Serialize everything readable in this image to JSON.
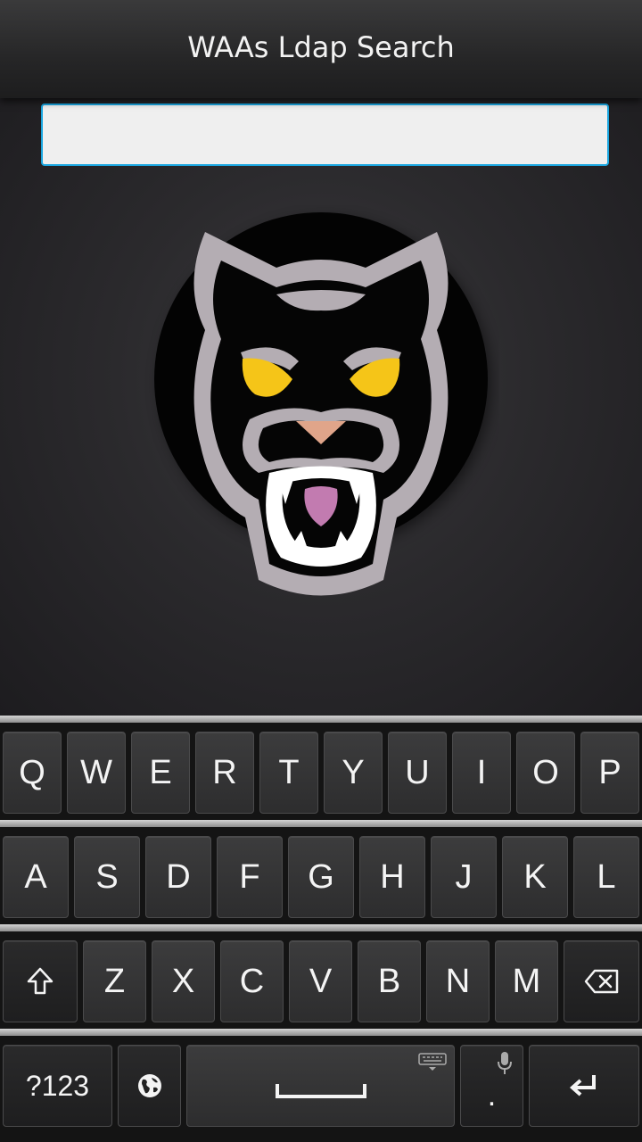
{
  "app": {
    "title": "WAAs Ldap Search"
  },
  "search": {
    "value": "",
    "placeholder": ""
  },
  "logo": {
    "icon": "panther-logo-icon"
  },
  "keyboard": {
    "row1": [
      "Q",
      "W",
      "E",
      "R",
      "T",
      "Y",
      "U",
      "I",
      "O",
      "P"
    ],
    "row2": [
      "A",
      "S",
      "D",
      "F",
      "G",
      "H",
      "J",
      "K",
      "L"
    ],
    "row3": [
      "Z",
      "X",
      "C",
      "V",
      "B",
      "N",
      "M"
    ],
    "symbols_label": "?123",
    "period_label": ".",
    "icons": {
      "shift": "shift-arrow-icon",
      "backspace": "backspace-icon",
      "globe": "globe-icon",
      "space": "space-bar-icon",
      "keyboard": "keyboard-icon",
      "mic": "microphone-icon",
      "enter": "enter-return-icon"
    }
  },
  "colors": {
    "accent": "#1aa6e0",
    "key_text": "#f4f4f4",
    "eye": "#f5c518",
    "tongue": "#c27bb0",
    "nose": "#e0a58a"
  }
}
